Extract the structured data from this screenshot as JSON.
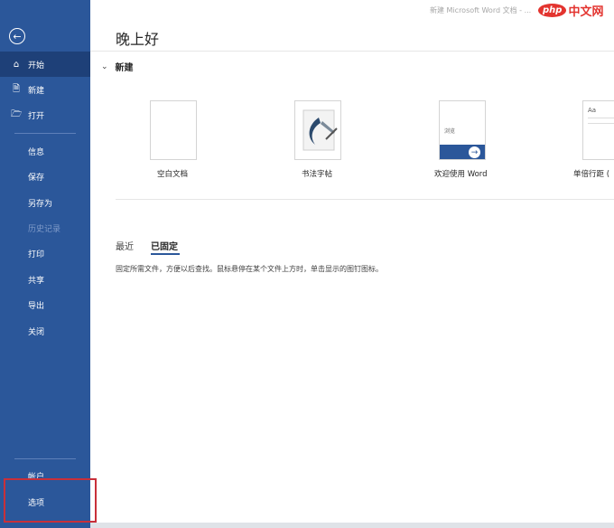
{
  "title_bar": {
    "doc_title": "新建 Microsoft Word 文档 - ...",
    "watermark_php": "php",
    "watermark_cn": "中文网"
  },
  "sidebar": {
    "back_icon": "arrow-left-circle-icon",
    "top_items": [
      {
        "label": "开始",
        "icon": "home-icon",
        "active": true
      },
      {
        "label": "新建",
        "icon": "new-document-icon"
      },
      {
        "label": "打开",
        "icon": "open-folder-icon"
      }
    ],
    "items": [
      {
        "label": "信息"
      },
      {
        "label": "保存"
      },
      {
        "label": "另存为"
      },
      {
        "label": "历史记录",
        "disabled": true
      },
      {
        "label": "打印"
      },
      {
        "label": "共享"
      },
      {
        "label": "导出"
      },
      {
        "label": "关闭"
      }
    ],
    "bottom_items": [
      {
        "label": "帐户"
      },
      {
        "label": "选项"
      }
    ],
    "highlight_color": "#c8303a",
    "color": "#2b579a"
  },
  "main": {
    "greeting": "晚上好",
    "new_section": {
      "label": "新建",
      "templates": [
        {
          "label": "空白文档"
        },
        {
          "label": "书法字帖"
        },
        {
          "label": "欢迎使用 Word",
          "thumb_text": "浏览"
        },
        {
          "label": "单倍行距 (",
          "thumb_text": "Aa"
        }
      ]
    },
    "tabs": [
      {
        "label": "最近"
      },
      {
        "label": "已固定",
        "selected": true
      }
    ],
    "pinned_hint": "固定所需文件，方便以后查找。鼠标悬停在某个文件上方时，单击显示的图钉图标。"
  }
}
